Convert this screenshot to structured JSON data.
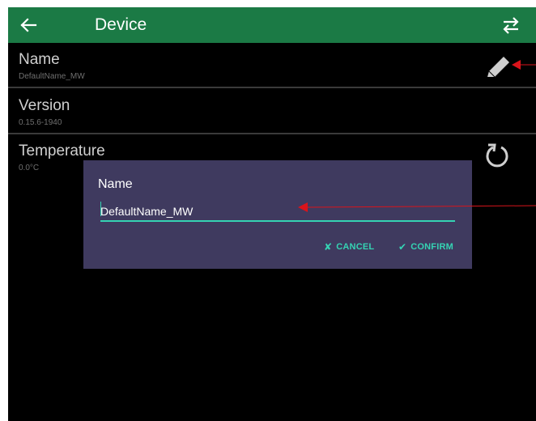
{
  "appbar": {
    "title": "Device",
    "back_icon": "arrow-left-icon",
    "swap_icon": "swap-arrows-icon",
    "color": "#1b7a45"
  },
  "rows": [
    {
      "label": "Name",
      "value": "DefaultName_MW",
      "action_icon": "pencil-icon"
    },
    {
      "label": "Version",
      "value": "0.15.6-1940"
    },
    {
      "label": "Temperature",
      "value": "0.0°C",
      "action_icon": "refresh-icon"
    }
  ],
  "dialog": {
    "title": "Name",
    "input_value": "DefaultName_MW",
    "cancel_label": "CANCEL",
    "confirm_label": "CONFIRM",
    "cancel_icon": "x-icon",
    "confirm_icon": "check-icon",
    "accent": "#35d3b3",
    "background": "#3f3a5f"
  },
  "annotations": {
    "arrow_color": "#d9141b"
  }
}
